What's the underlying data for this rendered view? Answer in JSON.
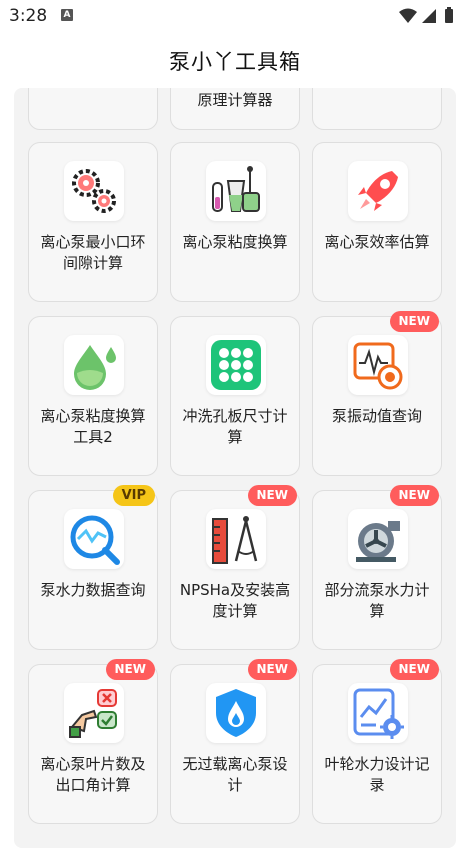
{
  "status_bar": {
    "time": "3:28",
    "notification_icon": "A"
  },
  "app": {
    "title": "泵小丫工具箱"
  },
  "top_row_partial_label": "原理计算器",
  "tools": [
    {
      "label": "离心泵最小口环间隙计算",
      "icon": "gears-icon",
      "badge": ""
    },
    {
      "label": "离心泵粘度换算",
      "icon": "lab-flask-icon",
      "badge": ""
    },
    {
      "label": "离心泵效率估算",
      "icon": "rocket-icon",
      "badge": ""
    },
    {
      "label": "离心泵粘度换算工具2",
      "icon": "water-drop-icon",
      "badge": ""
    },
    {
      "label": "冲洗孔板尺寸计算",
      "icon": "orifice-plate-icon",
      "badge": ""
    },
    {
      "label": "泵振动值查询",
      "icon": "vibration-monitor-icon",
      "badge": "NEW"
    },
    {
      "label": "泵水力数据查询",
      "icon": "chart-magnifier-icon",
      "badge": "VIP"
    },
    {
      "label": "NPSHa及安装高度计算",
      "icon": "ruler-compass-icon",
      "badge": "NEW"
    },
    {
      "label": "部分流泵水力计算",
      "icon": "pump-icon",
      "badge": "NEW"
    },
    {
      "label": "离心泵叶片数及出口角计算",
      "icon": "checklist-hand-icon",
      "badge": "NEW"
    },
    {
      "label": "无过载离心泵设计",
      "icon": "shield-flame-icon",
      "badge": "NEW"
    },
    {
      "label": "叶轮水力设计记录",
      "icon": "design-record-icon",
      "badge": "NEW"
    }
  ],
  "colors": {
    "badge_new": "#ff5c5c",
    "badge_vip": "#f5c518"
  }
}
